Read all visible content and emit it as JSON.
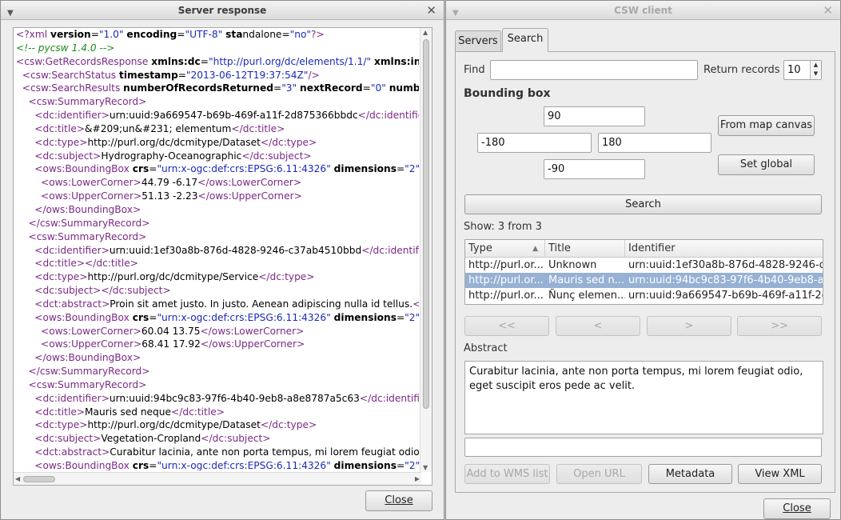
{
  "left_window": {
    "title": "Server response",
    "menu_icon": "chevron-down",
    "close_icon": "close-x",
    "close_button": "Close",
    "xml_lines": [
      [
        {
          "c": "tag",
          "t": "<?xml "
        },
        {
          "c": "attr",
          "t": "version"
        },
        {
          "c": "txt",
          "t": "="
        },
        {
          "c": "val",
          "t": "\"1.0\""
        },
        {
          "c": "txt",
          "t": " "
        },
        {
          "c": "attr",
          "t": "encoding"
        },
        {
          "c": "txt",
          "t": "="
        },
        {
          "c": "val",
          "t": "\"UTF-8\""
        },
        {
          "c": "txt",
          "t": " "
        },
        {
          "c": "attr",
          "t": "sta"
        },
        {
          "c": "txt",
          "t": "ndalone="
        },
        {
          "c": "val",
          "t": "\"no\""
        },
        {
          "c": "tag",
          "t": "?>"
        }
      ],
      [
        {
          "c": "comment",
          "t": "<!-- pycsw 1.4.0 -->"
        }
      ],
      [
        {
          "c": "tag",
          "t": "<csw:GetRecordsResponse "
        },
        {
          "c": "attr",
          "t": "xmlns:dc"
        },
        {
          "c": "txt",
          "t": "="
        },
        {
          "c": "val",
          "t": "\"http://purl.org/dc/elements/1.1/\""
        },
        {
          "c": "txt",
          "t": " "
        },
        {
          "c": "attr",
          "t": "xmlns:insp"
        }
      ],
      [
        {
          "c": "tag",
          "t": "  <csw:SearchStatus "
        },
        {
          "c": "attr",
          "t": "timestamp"
        },
        {
          "c": "txt",
          "t": "="
        },
        {
          "c": "val",
          "t": "\"2013-06-12T19:37:54Z\""
        },
        {
          "c": "tag",
          "t": "/>"
        }
      ],
      [
        {
          "c": "tag",
          "t": "  <csw:SearchResults "
        },
        {
          "c": "attr",
          "t": "numberOfRecordsReturned"
        },
        {
          "c": "txt",
          "t": "="
        },
        {
          "c": "val",
          "t": "\"3\""
        },
        {
          "c": "txt",
          "t": " "
        },
        {
          "c": "attr",
          "t": "nextRecord"
        },
        {
          "c": "txt",
          "t": "="
        },
        {
          "c": "val",
          "t": "\"0\""
        },
        {
          "c": "txt",
          "t": " "
        },
        {
          "c": "attr",
          "t": "numberOfR"
        }
      ],
      [
        {
          "c": "tag",
          "t": "    <csw:SummaryRecord>"
        }
      ],
      [
        {
          "c": "tag",
          "t": "      <dc:identifier>"
        },
        {
          "c": "txt",
          "t": "urn:uuid:9a669547-b69b-469f-a11f-2d875366bbdc"
        },
        {
          "c": "tag",
          "t": "</dc:identifier>"
        }
      ],
      [
        {
          "c": "tag",
          "t": "      <dc:title>"
        },
        {
          "c": "txt",
          "t": "&#209;un&#231; elementum"
        },
        {
          "c": "tag",
          "t": "</dc:title>"
        }
      ],
      [
        {
          "c": "tag",
          "t": "      <dc:type>"
        },
        {
          "c": "txt",
          "t": "http://purl.org/dc/dcmitype/Dataset"
        },
        {
          "c": "tag",
          "t": "</dc:type>"
        }
      ],
      [
        {
          "c": "tag",
          "t": "      <dc:subject>"
        },
        {
          "c": "txt",
          "t": "Hydrography-Oceanographic"
        },
        {
          "c": "tag",
          "t": "</dc:subject>"
        }
      ],
      [
        {
          "c": "tag",
          "t": "      <ows:BoundingBox "
        },
        {
          "c": "attr",
          "t": "crs"
        },
        {
          "c": "txt",
          "t": "="
        },
        {
          "c": "val",
          "t": "\"urn:x-ogc:def:crs:EPSG:6.11:4326\""
        },
        {
          "c": "txt",
          "t": " "
        },
        {
          "c": "attr",
          "t": "dimensions"
        },
        {
          "c": "txt",
          "t": "="
        },
        {
          "c": "val",
          "t": "\"2\""
        },
        {
          "c": "tag",
          "t": ">"
        }
      ],
      [
        {
          "c": "tag",
          "t": "        <ows:LowerCorner>"
        },
        {
          "c": "txt",
          "t": "44.79 -6.17"
        },
        {
          "c": "tag",
          "t": "</ows:LowerCorner>"
        }
      ],
      [
        {
          "c": "tag",
          "t": "        <ows:UpperCorner>"
        },
        {
          "c": "txt",
          "t": "51.13 -2.23"
        },
        {
          "c": "tag",
          "t": "</ows:UpperCorner>"
        }
      ],
      [
        {
          "c": "tag",
          "t": "      </ows:BoundingBox>"
        }
      ],
      [
        {
          "c": "tag",
          "t": "    </csw:SummaryRecord>"
        }
      ],
      [
        {
          "c": "tag",
          "t": "    <csw:SummaryRecord>"
        }
      ],
      [
        {
          "c": "tag",
          "t": "      <dc:identifier>"
        },
        {
          "c": "txt",
          "t": "urn:uuid:1ef30a8b-876d-4828-9246-c37ab4510bbd"
        },
        {
          "c": "tag",
          "t": "</dc:identifier>"
        }
      ],
      [
        {
          "c": "tag",
          "t": "      <dc:title></dc:title>"
        }
      ],
      [
        {
          "c": "tag",
          "t": "      <dc:type>"
        },
        {
          "c": "txt",
          "t": "http://purl.org/dc/dcmitype/Service"
        },
        {
          "c": "tag",
          "t": "</dc:type>"
        }
      ],
      [
        {
          "c": "tag",
          "t": "      <dc:subject></dc:subject>"
        }
      ],
      [
        {
          "c": "tag",
          "t": "      <dct:abstract>"
        },
        {
          "c": "txt",
          "t": "Proin sit amet justo. In justo. Aenean adipiscing nulla id tellus."
        },
        {
          "c": "tag",
          "t": "</dc"
        }
      ],
      [
        {
          "c": "tag",
          "t": "      <ows:BoundingBox "
        },
        {
          "c": "attr",
          "t": "crs"
        },
        {
          "c": "txt",
          "t": "="
        },
        {
          "c": "val",
          "t": "\"urn:x-ogc:def:crs:EPSG:6.11:4326\""
        },
        {
          "c": "txt",
          "t": " "
        },
        {
          "c": "attr",
          "t": "dimensions"
        },
        {
          "c": "txt",
          "t": "="
        },
        {
          "c": "val",
          "t": "\"2\""
        },
        {
          "c": "tag",
          "t": ">"
        }
      ],
      [
        {
          "c": "tag",
          "t": "        <ows:LowerCorner>"
        },
        {
          "c": "txt",
          "t": "60.04 13.75"
        },
        {
          "c": "tag",
          "t": "</ows:LowerCorner>"
        }
      ],
      [
        {
          "c": "tag",
          "t": "        <ows:UpperCorner>"
        },
        {
          "c": "txt",
          "t": "68.41 17.92"
        },
        {
          "c": "tag",
          "t": "</ows:UpperCorner>"
        }
      ],
      [
        {
          "c": "tag",
          "t": "      </ows:BoundingBox>"
        }
      ],
      [
        {
          "c": "tag",
          "t": "    </csw:SummaryRecord>"
        }
      ],
      [
        {
          "c": "tag",
          "t": "    <csw:SummaryRecord>"
        }
      ],
      [
        {
          "c": "tag",
          "t": "      <dc:identifier>"
        },
        {
          "c": "txt",
          "t": "urn:uuid:94bc9c83-97f6-4b40-9eb8-a8e8787a5c63"
        },
        {
          "c": "tag",
          "t": "</dc:identifier>"
        }
      ],
      [
        {
          "c": "tag",
          "t": "      <dc:title>"
        },
        {
          "c": "txt",
          "t": "Mauris sed neque"
        },
        {
          "c": "tag",
          "t": "</dc:title>"
        }
      ],
      [
        {
          "c": "tag",
          "t": "      <dc:type>"
        },
        {
          "c": "txt",
          "t": "http://purl.org/dc/dcmitype/Dataset"
        },
        {
          "c": "tag",
          "t": "</dc:type>"
        }
      ],
      [
        {
          "c": "tag",
          "t": "      <dc:subject>"
        },
        {
          "c": "txt",
          "t": "Vegetation-Cropland"
        },
        {
          "c": "tag",
          "t": "</dc:subject>"
        }
      ],
      [
        {
          "c": "tag",
          "t": "      <dct:abstract>"
        },
        {
          "c": "txt",
          "t": "Curabitur lacinia, ante non porta tempus, mi lorem feugiat odio, eg"
        }
      ],
      [
        {
          "c": "tag",
          "t": "      <ows:BoundingBox "
        },
        {
          "c": "attr",
          "t": "crs"
        },
        {
          "c": "txt",
          "t": "="
        },
        {
          "c": "val",
          "t": "\"urn:x-ogc:def:crs:EPSG:6.11:4326\""
        },
        {
          "c": "txt",
          "t": " "
        },
        {
          "c": "attr",
          "t": "dimensions"
        },
        {
          "c": "txt",
          "t": "="
        },
        {
          "c": "val",
          "t": "\"2\""
        },
        {
          "c": "tag",
          "t": ">"
        }
      ]
    ]
  },
  "right_window": {
    "title": "CSW client",
    "tabs": [
      {
        "label": "Servers"
      },
      {
        "label": "Search"
      }
    ],
    "find_label": "Find",
    "find_value": "",
    "return_records_label": "Return records",
    "return_records_value": "10",
    "bounding_box_label": "Bounding box",
    "bbox": {
      "north": "90",
      "west": "-180",
      "east": "180",
      "south": "-90"
    },
    "from_map_canvas": "From map canvas",
    "set_global": "Set global",
    "search_button": "Search",
    "show_text": "Show: 3 from 3",
    "columns": [
      "Type",
      "Title",
      "Identifier"
    ],
    "rows": [
      {
        "type": "http://purl.or...",
        "title": "Unknown",
        "identifier": "urn:uuid:1ef30a8b-876d-4828-9246-c3..."
      },
      {
        "type": "http://purl.or...",
        "title": "Mauris sed n...",
        "identifier": "urn:uuid:94bc9c83-97f6-4b40-9eb8-a8..."
      },
      {
        "type": "http://purl.or...",
        "title": "Ñunç elemen...",
        "identifier": "urn:uuid:9a669547-b69b-469f-a11f-2d..."
      }
    ],
    "selected_row": 1,
    "nav": {
      "first": "<<",
      "prev": "<",
      "next": ">",
      "last": ">>"
    },
    "abstract_label": "Abstract",
    "abstract_text": "Curabitur lacinia, ante non porta tempus, mi lorem feugiat odio, eget suscipit eros pede ac velit.",
    "url_value": "",
    "add_to_wms": "Add to WMS list",
    "open_url": "Open URL",
    "metadata": "Metadata",
    "view_xml": "View XML",
    "close_button": "Close"
  },
  "colors": {
    "selection": "#96b1d4",
    "xml_tag": "#7b2a86",
    "xml_value": "#1a2ab8",
    "xml_comment": "#1f8a1f"
  }
}
